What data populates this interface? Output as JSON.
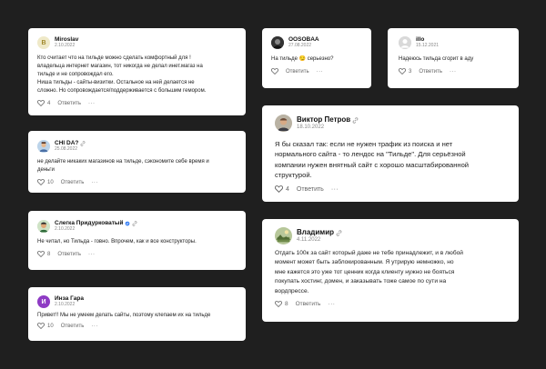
{
  "comments": [
    {
      "name": "Miroslav",
      "date": "2.10.2022",
      "lines": [
        "Кто считает что на тильде можно сделать комфортный для !",
        "владельца интернет магазин, тот никогда не делал инет.магаз на",
        "тильде и не сопровождал его.",
        "Ниша тильды - сайты-визитки. Остальное на ней делается не",
        "сложно. Но сопровождается/поддерживается с большим гемором."
      ],
      "likes": "4",
      "reply": "Ответить",
      "avatar_letter": "B"
    },
    {
      "name": "CHI DA?",
      "date": "25.08.2022",
      "lines": [
        "не делайте никаких магазинов на тильде, сэкономите себе время и",
        "деньги"
      ],
      "likes": "10",
      "reply": "Ответить"
    },
    {
      "name": "Слегка Придурковатый",
      "date": "2.10.2022",
      "lines": [
        "Не читал, но Тильда - говно. Впрочем, как и все конструкторы."
      ],
      "likes": "8",
      "reply": "Ответить"
    },
    {
      "name": "Инза Гара",
      "date": "2.10.2022",
      "lines": [
        "Привет!! Мы не умеем делать сайты, поэтому клепаем их на тильде"
      ],
      "likes": "10",
      "reply": "Ответить",
      "avatar_letter": "И"
    },
    {
      "name": "OOSOBAA",
      "date": "27.08.2022",
      "lines": [
        "На тильде 😏 серьезно?"
      ],
      "likes": "",
      "reply": "Ответить"
    },
    {
      "name": "illo",
      "date": "15.12.2021",
      "lines": [
        "Надеюсь тильда сгорит в аду"
      ],
      "likes": "3",
      "reply": "Ответить"
    },
    {
      "name": "Виктор Петров",
      "date": "18.10.2022",
      "lines": [
        "Я бы сказал так: если не нужен трафик из поиска и нет",
        "нормального сайта - то лендос на \"Тильде\". Для серьёзной",
        "компании нужен внятный сайт с хорошо масштабированной",
        "структурой."
      ],
      "likes": "4",
      "reply": "Ответить"
    },
    {
      "name": "Владимир",
      "date": "4.11.2022",
      "lines": [
        "Отдать 100к за сайт который даже не тебе принадлежит, и в любой",
        "момент может быть заблокированным. Я утрирую немножко, но",
        "мне кажется это уже тот ценник когда клиенту нужно не бояться",
        "покупать хостинг, домен, и заказывать тоже самое по сути на",
        "вордпрессе."
      ],
      "likes": "8",
      "reply": "Ответить"
    }
  ],
  "more_label": "···",
  "colors": {
    "background": "#1f1f1f",
    "card": "#ffffff",
    "verified": "#3b82f6"
  },
  "icons": {
    "like": "heart-icon",
    "edited": "link-icon",
    "verified": "verified-badge-icon"
  }
}
